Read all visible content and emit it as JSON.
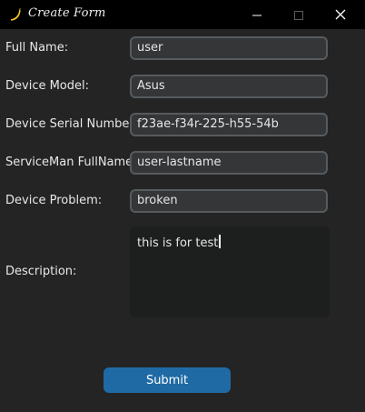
{
  "window": {
    "title": "Create Form",
    "icon": "banana-icon"
  },
  "form": {
    "full_name": {
      "label": "Full Name:",
      "value": "user"
    },
    "device_model": {
      "label": "Device Model:",
      "value": "Asus"
    },
    "serial_number": {
      "label": "Device Serial Number:",
      "value": "f23ae-f34r-225-h55-54b"
    },
    "serviceman_fullname": {
      "label": "ServiceMan FullName:",
      "value": "user-lastname"
    },
    "device_problem": {
      "label": "Device Problem:",
      "value": "broken"
    },
    "description": {
      "label": "Description:",
      "value": "this is for test"
    }
  },
  "submit_label": "Submit",
  "colors": {
    "titlebar": "#000000",
    "background": "#242424",
    "field_bg": "#343638",
    "field_border": "#565b5e",
    "textbox_bg": "#1d1e1e",
    "button": "#1f6aa5"
  }
}
